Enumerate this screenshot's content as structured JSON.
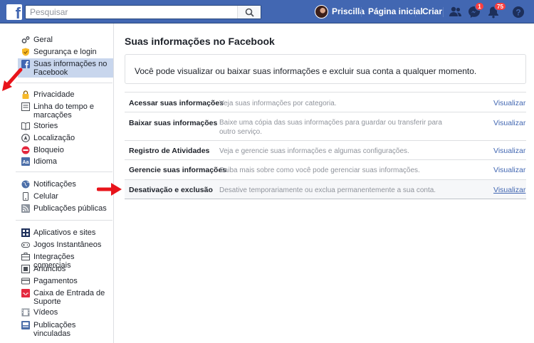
{
  "header": {
    "logo_letter": "f",
    "search_placeholder": "Pesquisar",
    "user_name": "Priscilla",
    "home_label": "Página inicial",
    "create_label": "Criar",
    "messages_badge": "1",
    "notifications_badge": "75"
  },
  "sidebar": {
    "groups": [
      [
        {
          "label": "Geral",
          "icon": "gears-icon"
        },
        {
          "label": "Segurança e login",
          "icon": "shield-icon"
        },
        {
          "label": "Suas informações no Facebook",
          "icon": "facebook-icon",
          "active": true
        }
      ],
      [
        {
          "label": "Privacidade",
          "icon": "lock-icon"
        },
        {
          "label": "Linha do tempo e marcações",
          "icon": "timeline-icon"
        },
        {
          "label": "Stories",
          "icon": "book-icon"
        },
        {
          "label": "Localização",
          "icon": "location-icon"
        },
        {
          "label": "Bloqueio",
          "icon": "block-icon"
        },
        {
          "label": "Idioma",
          "icon": "language-icon"
        }
      ],
      [
        {
          "label": "Notificações",
          "icon": "globe-icon"
        },
        {
          "label": "Celular",
          "icon": "phone-icon"
        },
        {
          "label": "Publicações públicas",
          "icon": "rss-icon"
        }
      ],
      [
        {
          "label": "Aplicativos e sites",
          "icon": "apps-icon"
        },
        {
          "label": "Jogos Instantâneos",
          "icon": "gamepad-icon"
        },
        {
          "label": "Integrações comerciais",
          "icon": "integrations-icon"
        },
        {
          "label": "Anúncios",
          "icon": "ads-icon"
        },
        {
          "label": "Pagamentos",
          "icon": "card-icon"
        },
        {
          "label": "Caixa de Entrada de Suporte",
          "icon": "support-icon"
        },
        {
          "label": "Vídeos",
          "icon": "film-icon"
        },
        {
          "label": "Publicações vinculadas",
          "icon": "linked-posts-icon"
        }
      ]
    ]
  },
  "main": {
    "title": "Suas informações no Facebook",
    "info_text": "Você pode visualizar ou baixar suas informações e excluir sua conta a qualquer momento.",
    "rows": [
      {
        "title": "Acessar suas informações",
        "desc": "Veja suas informações por categoria.",
        "link": "Visualizar"
      },
      {
        "title": "Baixar suas informações",
        "desc": "Baixe uma cópia das suas informações para guardar ou transferir para outro serviço.",
        "link": "Visualizar"
      },
      {
        "title": "Registro de Atividades",
        "desc": "Veja e gerencie suas informações e algumas configurações.",
        "link": "Visualizar"
      },
      {
        "title": "Gerencie suas informações",
        "desc": "Saiba mais sobre como você pode gerenciar suas informações.",
        "link": "Visualizar"
      },
      {
        "title": "Desativação e exclusão",
        "desc": "Desative temporariamente ou exclua permanentemente a sua conta.",
        "link": "Visualizar",
        "highlight": true
      }
    ]
  },
  "colors": {
    "brand": "#4267b2",
    "link": "#4267b2",
    "arrow": "#e8141b",
    "active_item": "#c8d6ed",
    "badge": "#fa3e3e"
  }
}
